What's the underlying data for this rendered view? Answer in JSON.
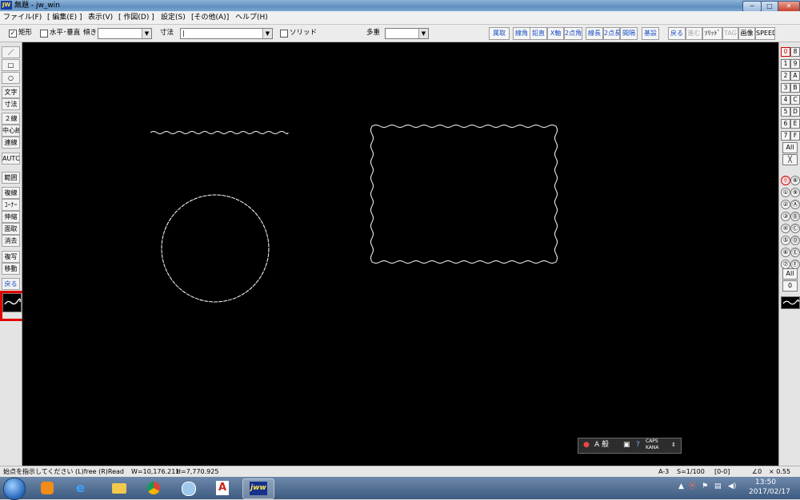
{
  "window": {
    "title": "無題 - jw_win",
    "app_icon_label": "JW",
    "buttons": {
      "minimize": "─",
      "maximize": "□",
      "close": "✕"
    }
  },
  "menubar": {
    "items": [
      "ファイル(F)",
      "[ 編集(E) ]",
      "表示(V)",
      "[ 作図(D) ]",
      "設定(S)",
      "[その他(A)]",
      "ヘルプ(H)"
    ]
  },
  "toolbar": {
    "rect_check_label": "矩形",
    "rect_checked": true,
    "horiz_vert_label": "水平･垂直",
    "horiz_vert_checked": false,
    "slope_label": "傾き",
    "slope_value": "",
    "dimension_label": "寸法",
    "dimension_value": "|",
    "solid_label": "ソリッド",
    "solid_checked": false,
    "multiplex_label": "多重",
    "multiplex_value": "",
    "buttons": [
      "属取",
      "線角",
      "鉛直",
      "X軸",
      "2点角",
      "線長",
      "2点長",
      "間隔",
      "基設",
      "戻る",
      "進む",
      "ｿﾘｯﾄﾞ",
      "TAG",
      "画像",
      "SPEED"
    ]
  },
  "left_toolbar": {
    "tools": [
      "／",
      "□",
      "○",
      "文字",
      "寸法",
      "２線",
      "中心線",
      "連線",
      "AUTO",
      "範囲",
      "複線",
      "ｺｰﾅｰ",
      "伸縮",
      "面取",
      "消去",
      "複写",
      "移動",
      "戻る"
    ],
    "selected_tool_icon": "wave-line-icon"
  },
  "right_toolbar": {
    "layer_groups": [
      "0",
      "1",
      "2",
      "3",
      "4",
      "5",
      "6",
      "7"
    ],
    "layer_groups_hex": [
      "8",
      "9",
      "A",
      "B",
      "C",
      "D",
      "E",
      "F"
    ],
    "all_label": "All",
    "cross_label": "╳",
    "layers_circled": [
      "⓪",
      "①",
      "②",
      "③",
      "④",
      "⑤",
      "⑥",
      "⑦"
    ],
    "layers_circled_right": [
      "⑧",
      "⑨",
      "Ⓐ",
      "Ⓑ",
      "Ⓒ",
      "Ⓓ",
      "Ⓔ",
      "Ⓕ"
    ],
    "all_label_2": "All",
    "zero_label": "0"
  },
  "ime": {
    "mode": "A 般",
    "caps_label": "CAPS",
    "kana_label": "KANA",
    "help": "?"
  },
  "statusbar": {
    "prompt": "始点を指示してください (L)free (R)Read",
    "width": "W=10,176.211",
    "height": "H=7,770.925",
    "paper": "A-3",
    "scale": "S=1/100",
    "layer": "[0-0]",
    "angle": "∠0",
    "zoom": "× 0.55"
  },
  "taskbar": {
    "time": "13:50",
    "date": "2017/02/17",
    "apps": [
      "windows-media-player",
      "internet-explorer",
      "file-explorer",
      "chrome",
      "pinwheel-app",
      "adobe-reader",
      "jw-win"
    ]
  },
  "colors": {
    "canvas_bg": "#000000",
    "drawing_line": "#ffffff",
    "highlight": "#e00000",
    "accent_blue": "#1b4fc7"
  }
}
